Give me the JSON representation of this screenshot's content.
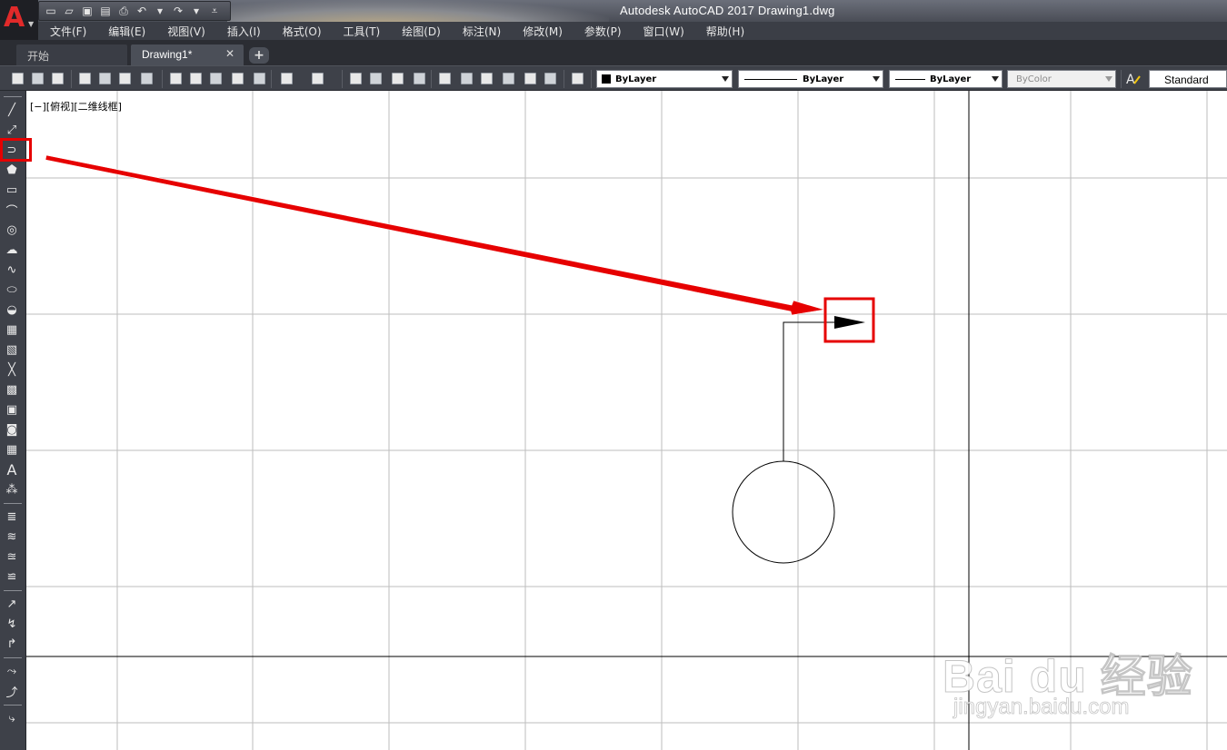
{
  "window": {
    "title": "Autodesk AutoCAD 2017    Drawing1.dwg",
    "app_logo_letter": "A"
  },
  "menu": {
    "items": [
      "文件(F)",
      "编辑(E)",
      "视图(V)",
      "插入(I)",
      "格式(O)",
      "工具(T)",
      "绘图(D)",
      "标注(N)",
      "修改(M)",
      "参数(P)",
      "窗口(W)",
      "帮助(H)"
    ]
  },
  "tabs": {
    "start": "开始",
    "drawing": "Drawing1*",
    "close_glyph": "✕",
    "new_glyph": "+"
  },
  "properties": {
    "color": "ByLayer",
    "linetype": "ByLayer",
    "lineweight": "ByLayer",
    "plotstyle": "ByColor",
    "textstyle": "Standard"
  },
  "viewport": {
    "label": "[−][俯视][二维线框]"
  },
  "annotation": {
    "color": "#e60000"
  },
  "watermark": {
    "main": "Bai du 经验",
    "sub": "jingyan.baidu.com"
  }
}
